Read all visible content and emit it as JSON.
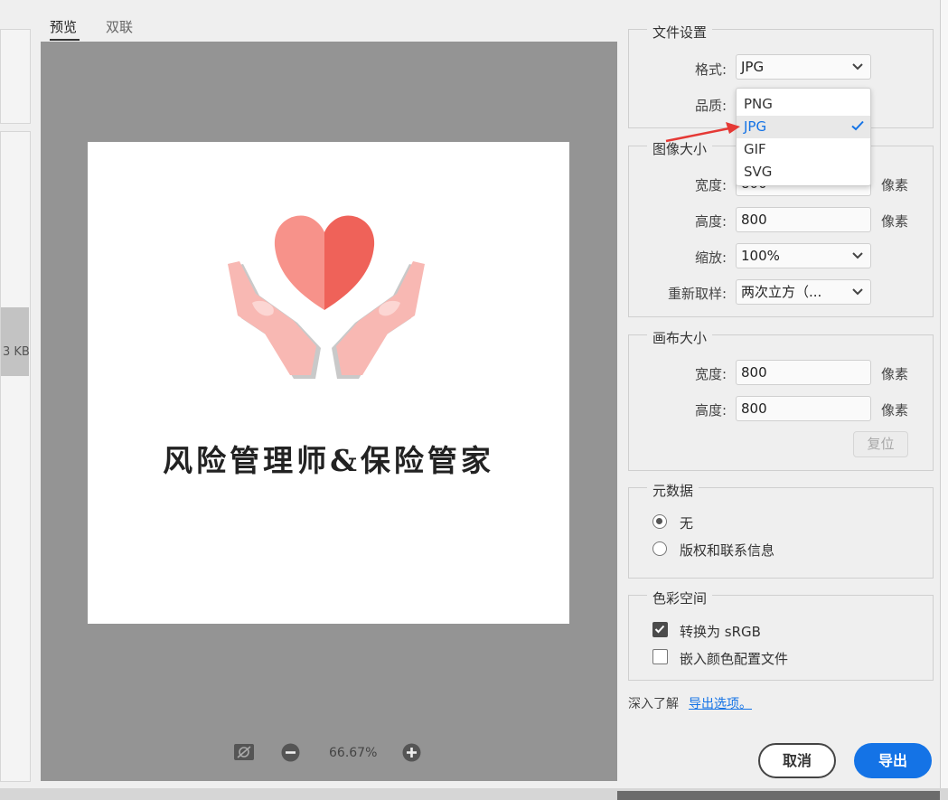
{
  "tabs": {
    "preview": "预览",
    "two_up": "双联"
  },
  "left_panel": {
    "size_fragment": "3 KB"
  },
  "preview": {
    "logo_text": "风险管理师&保险管家",
    "zoom": "66.67%"
  },
  "file_settings": {
    "title": "文件设置",
    "format_label": "格式:",
    "format_value": "JPG",
    "quality_label": "品质:",
    "format_options": [
      "PNG",
      "JPG",
      "GIF",
      "SVG"
    ],
    "selected_option": "JPG"
  },
  "image_size": {
    "title": "图像大小",
    "width_label": "宽度:",
    "width_value": "800",
    "height_label": "高度:",
    "height_value": "800",
    "unit": "像素",
    "scale_label": "缩放:",
    "scale_value": "100%",
    "resample_label": "重新取样:",
    "resample_value": "两次立方（..."
  },
  "canvas_size": {
    "title": "画布大小",
    "width_label": "宽度:",
    "width_value": "800",
    "height_label": "高度:",
    "height_value": "800",
    "unit": "像素",
    "reset_label": "复位"
  },
  "metadata": {
    "title": "元数据",
    "option_none": "无",
    "option_copyright": "版权和联系信息"
  },
  "color_space": {
    "title": "色彩空间",
    "convert_srgb": "转换为 sRGB",
    "convert_checked": true,
    "embed_profile": "嵌入颜色配置文件",
    "embed_checked": false
  },
  "footer": {
    "learn_more": "深入了解",
    "export_options_link": "导出选项。",
    "cancel": "取消",
    "export": "导出"
  },
  "colors": {
    "accent": "#1473e6",
    "arrow": "#e53935",
    "heart_left": "#f7928a",
    "heart_right": "#ef6259",
    "hands": "#f8b8b3"
  }
}
